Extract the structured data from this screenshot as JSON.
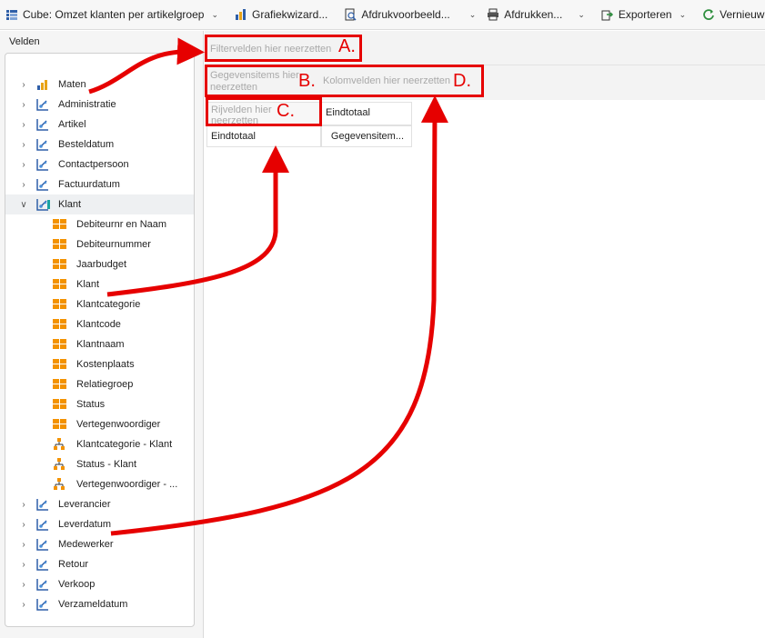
{
  "toolbar": {
    "cube_label": "Cube: Omzet klanten per artikelgroep",
    "chart_label": "Grafiekwizard...",
    "preview_label": "Afdrukvoorbeeld...",
    "print_label": "Afdrukken...",
    "export_label": "Exporteren",
    "refresh_label": "Vernieuwen"
  },
  "fields": {
    "header": "Velden",
    "items": [
      {
        "label": "Maten"
      },
      {
        "label": "Administratie"
      },
      {
        "label": "Artikel"
      },
      {
        "label": "Besteldatum"
      },
      {
        "label": "Contactpersoon"
      },
      {
        "label": "Factuurdatum"
      },
      {
        "label": "Klant"
      },
      {
        "label": "Debiteurnr en Naam"
      },
      {
        "label": "Debiteurnummer"
      },
      {
        "label": "Jaarbudget"
      },
      {
        "label": "Klant"
      },
      {
        "label": "Klantcategorie"
      },
      {
        "label": "Klantcode"
      },
      {
        "label": "Klantnaam"
      },
      {
        "label": "Kostenplaats"
      },
      {
        "label": "Relatiegroep"
      },
      {
        "label": "Status"
      },
      {
        "label": "Vertegenwoordiger"
      },
      {
        "label": "Klantcategorie - Klant"
      },
      {
        "label": "Status - Klant"
      },
      {
        "label": "Vertegenwoordiger - ..."
      },
      {
        "label": "Leverancier"
      },
      {
        "label": "Leverdatum"
      },
      {
        "label": "Medewerker"
      },
      {
        "label": "Retour"
      },
      {
        "label": "Verkoop"
      },
      {
        "label": "Verzameldatum"
      }
    ]
  },
  "zones": {
    "filter_placeholder": "Filtervelden hier neerzetten",
    "data_placeholder": "Gegevensitems hier neerzetten",
    "column_placeholder": "Kolomvelden hier neerzetten",
    "row_placeholder": "Rijvelden hier neerzetten"
  },
  "pivot": {
    "col_header": "Eindtotaal",
    "row_header": "Eindtotaal",
    "value_cell": "Gegevensitem..."
  },
  "annotations": {
    "a": "A.",
    "b": "B.",
    "c": "C.",
    "d": "D."
  },
  "colors": {
    "annotation_red": "#e60000",
    "measure_orange": "#e8a317",
    "dimension_blue": "#2f5fa8",
    "attribute_orange": "#f39200"
  }
}
